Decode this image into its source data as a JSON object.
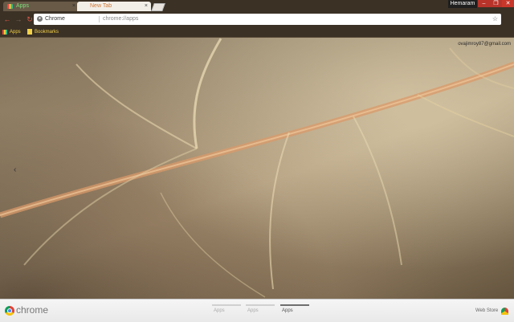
{
  "window": {
    "tabs": [
      {
        "label": "Apps",
        "close": "×"
      },
      {
        "label": "New Tab",
        "close": "×"
      }
    ],
    "profile_name": "Hemaram",
    "controls": {
      "minimize": "–",
      "maximize": "❐",
      "close": "✕"
    }
  },
  "toolbar": {
    "back": "←",
    "forward": "→",
    "reload": "↻",
    "omnibox_chip": "Chrome",
    "url": "chrome://apps",
    "star": "☆"
  },
  "bookmarks": {
    "items": [
      {
        "label": "Apps"
      },
      {
        "label": "Bookmarks"
      }
    ]
  },
  "ntp": {
    "account_email": "ovajimroy87@gmail.com",
    "prev_arrow": "‹"
  },
  "footer": {
    "logo_text": "chrome",
    "pages": [
      {
        "label": "Apps",
        "active": false
      },
      {
        "label": "Apps",
        "active": false
      },
      {
        "label": "Apps",
        "active": true
      }
    ],
    "web_store_label": "Web Store"
  },
  "colors": {
    "tab_strip": "#3b3125",
    "bookmark_text": "#f3d24a",
    "close_red": "#c9372a"
  }
}
